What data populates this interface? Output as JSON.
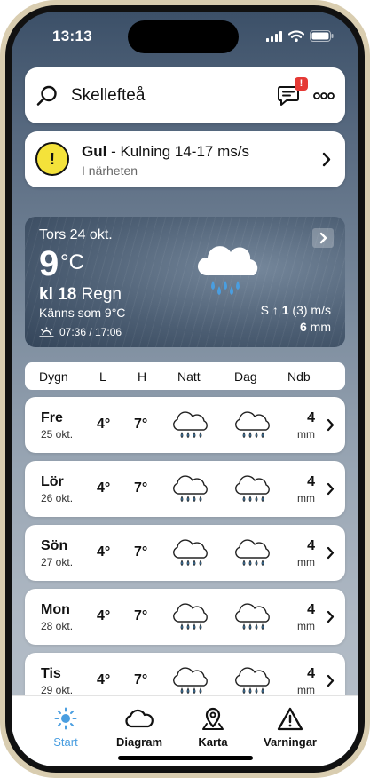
{
  "status_bar": {
    "time": "13:13"
  },
  "search": {
    "location": "Skellefteå",
    "badge_count": "!"
  },
  "warning": {
    "level": "Gul",
    "text": " - Kulning 14-17 ms/s",
    "sub": "I närheten"
  },
  "current": {
    "date": "Tors 24 okt.",
    "temp": "9",
    "unit": "°C",
    "hour_prefix": "kl ",
    "hour": "18",
    "condition": " Regn",
    "feels_like": "Känns som 9°C",
    "sun": "07:36 / 17:06",
    "wind_dir": "S ↑ ",
    "wind_speed": "1",
    "wind_gust": " (3) m/s",
    "precip_value": "6",
    "precip_unit": " mm"
  },
  "table_header": {
    "day": "Dygn",
    "low": "L",
    "high": "H",
    "night": "Natt",
    "daytime": "Dag",
    "precip": "Ndb"
  },
  "forecast": [
    {
      "name": "Fre",
      "date": "25 okt.",
      "low": "4°",
      "high": "7°",
      "precip": "4",
      "unit": "mm"
    },
    {
      "name": "Lör",
      "date": "26 okt.",
      "low": "4°",
      "high": "7°",
      "precip": "4",
      "unit": "mm"
    },
    {
      "name": "Sön",
      "date": "27 okt.",
      "low": "4°",
      "high": "7°",
      "precip": "4",
      "unit": "mm"
    },
    {
      "name": "Mon",
      "date": "28 okt.",
      "low": "4°",
      "high": "7°",
      "precip": "4",
      "unit": "mm"
    },
    {
      "name": "Tis",
      "date": "29 okt.",
      "low": "4°",
      "high": "7°",
      "precip": "4",
      "unit": "mm"
    }
  ],
  "tabs": [
    {
      "label": "Start",
      "icon": "sun-icon",
      "active": true
    },
    {
      "label": "Diagram",
      "icon": "cloud-icon",
      "active": false
    },
    {
      "label": "Karta",
      "icon": "map-pin-icon",
      "active": false
    },
    {
      "label": "Varningar",
      "icon": "warning-triangle-icon",
      "active": false
    }
  ],
  "colors": {
    "accent": "#4a9ee0",
    "warning_yellow": "#f4e23a",
    "badge_red": "#e53935"
  }
}
